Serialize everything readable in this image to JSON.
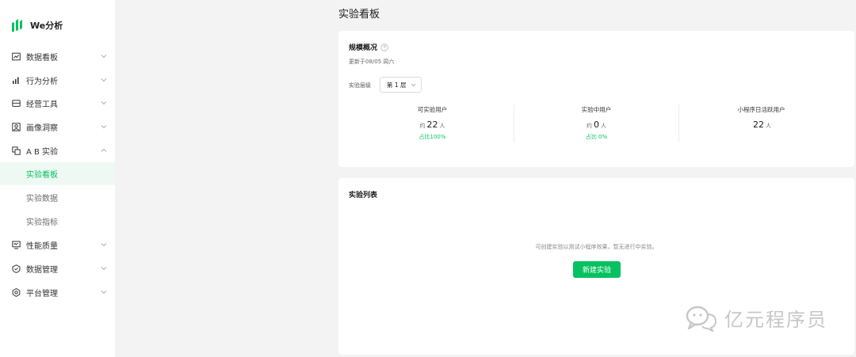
{
  "brand": {
    "name": "We分析",
    "logo_icon": "bars-logo-icon",
    "accent_color": "#07c160"
  },
  "sidebar": {
    "items": [
      {
        "label": "数据看板",
        "icon": "dashboard-icon",
        "expanded": false
      },
      {
        "label": "行为分析",
        "icon": "bar-chart-icon",
        "expanded": false
      },
      {
        "label": "经营工具",
        "icon": "wallet-icon",
        "expanded": false
      },
      {
        "label": "画像洞察",
        "icon": "portrait-icon",
        "expanded": false
      },
      {
        "label": "A B 实验",
        "icon": "copy-squares-icon",
        "expanded": true
      },
      {
        "label": "性能质量",
        "icon": "monitor-icon",
        "expanded": false
      },
      {
        "label": "数据管理",
        "icon": "shield-check-icon",
        "expanded": false
      },
      {
        "label": "平台管理",
        "icon": "hexagon-gear-icon",
        "expanded": false
      }
    ],
    "ab_sub_items": [
      {
        "label": "实验看板",
        "active": true
      },
      {
        "label": "实验数据",
        "active": false
      },
      {
        "label": "实验指标",
        "active": false
      }
    ]
  },
  "page": {
    "title": "实验看板"
  },
  "overview": {
    "title": "规模概况",
    "help_icon": "question-circle-icon",
    "updated": "更新于08/05 周六",
    "layer_label": "实验层级",
    "layer_value": "第 1 层",
    "stats": [
      {
        "label": "可实验用户",
        "prefix": "约",
        "value": "22",
        "unit": "人",
        "percent": "占比100%"
      },
      {
        "label": "实验中用户",
        "prefix": "约",
        "value": "0",
        "unit": "人",
        "percent": "占比 0%"
      },
      {
        "label": "小程序日活跃用户",
        "prefix": "",
        "value": "22",
        "unit": "人",
        "percent": ""
      }
    ]
  },
  "experiment_list": {
    "title": "实验列表",
    "empty_text": "可创建实验以测试小程序效果，暂无进行中实验。",
    "new_button": "新建实验"
  },
  "watermark": {
    "text": "亿元程序员",
    "icon": "wechat-official-account-icon"
  }
}
